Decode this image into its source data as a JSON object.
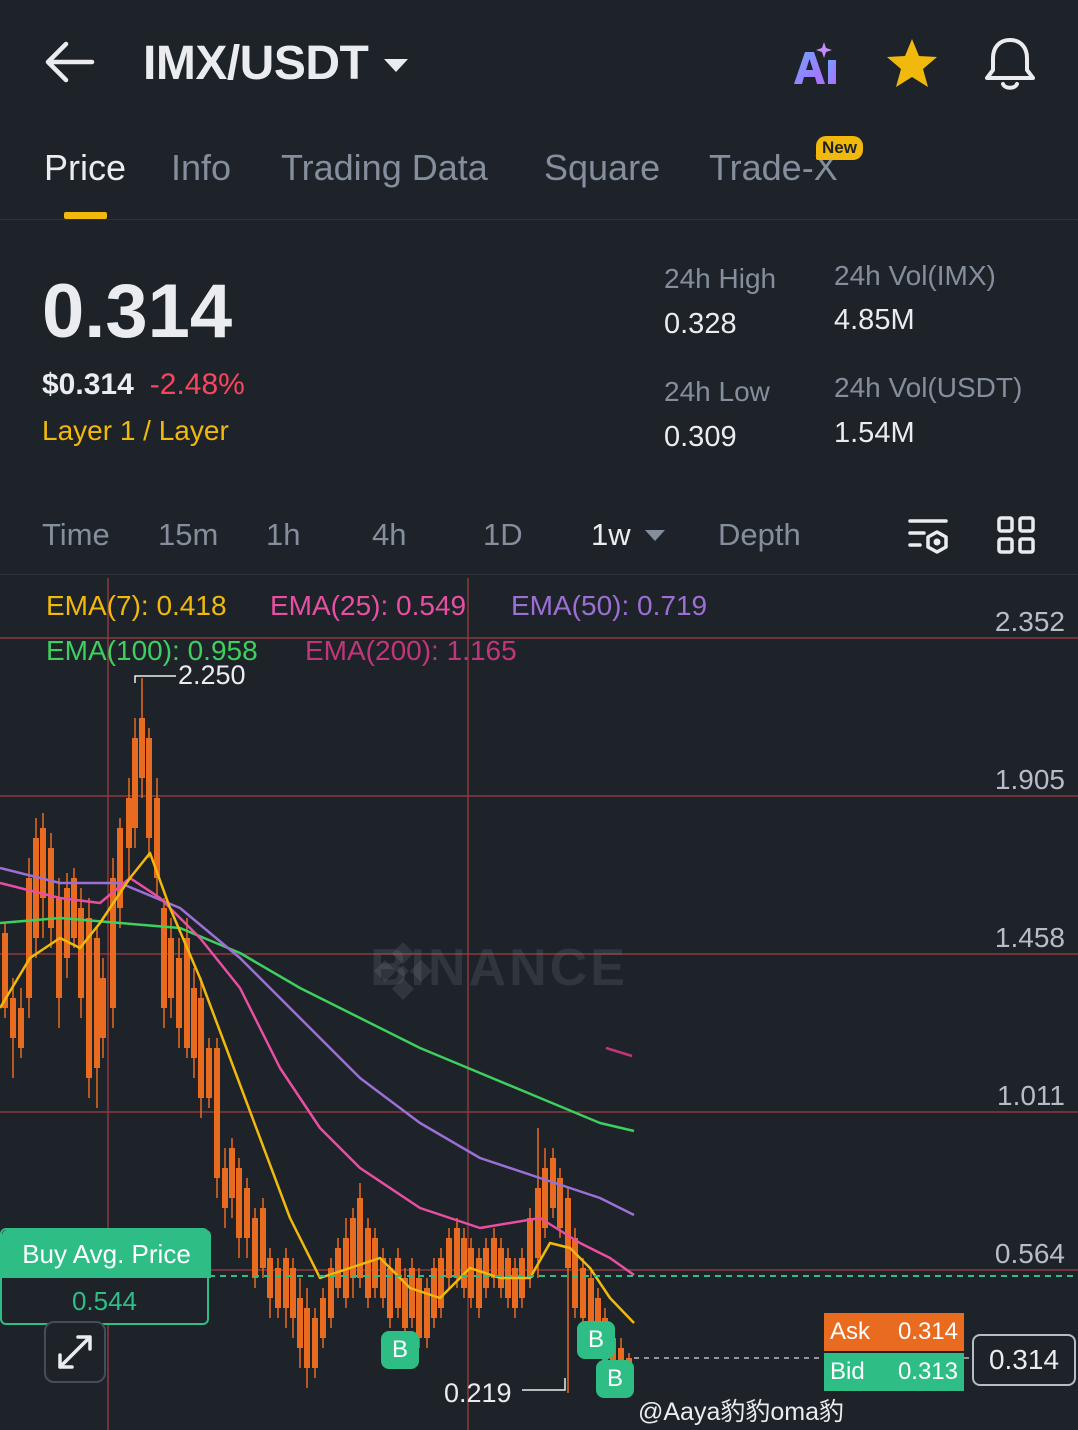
{
  "header": {
    "pair": "IMX/USDT",
    "ai_label": "AI"
  },
  "tabs": [
    {
      "label": "Price"
    },
    {
      "label": "Info"
    },
    {
      "label": "Trading Data"
    },
    {
      "label": "Square"
    },
    {
      "label": "Trade-X"
    }
  ],
  "new_badge": "New",
  "price": {
    "last": "0.314",
    "usd": "$0.314",
    "change": "-2.48%",
    "category": "Layer 1 / Layer"
  },
  "stats": {
    "high_label": "24h High",
    "high": "0.328",
    "low_label": "24h Low",
    "low": "0.309",
    "vol_base_label": "24h Vol(IMX)",
    "vol_base": "4.85M",
    "vol_quote_label": "24h Vol(USDT)",
    "vol_quote": "1.54M"
  },
  "intervals": [
    {
      "label": "Time"
    },
    {
      "label": "15m"
    },
    {
      "label": "1h"
    },
    {
      "label": "4h"
    },
    {
      "label": "1D"
    },
    {
      "label": "1w"
    },
    {
      "label": "Depth"
    }
  ],
  "ema": {
    "ema7": "EMA(7): 0.418",
    "ema25": "EMA(25): 0.549",
    "ema50": "EMA(50): 0.719",
    "ema100": "EMA(100): 0.958",
    "ema200": "EMA(200): 1.165"
  },
  "colors": {
    "ema7": "#f0b90b",
    "ema25": "#e84fa3",
    "ema50": "#9c6fd6",
    "ema100": "#3ecf5e",
    "ema200": "#c2357a",
    "up": "#2ebd85",
    "down": "#e96b1f",
    "gridline": "#8a3a3f"
  },
  "y_axis": [
    "2.352",
    "1.905",
    "1.458",
    "1.011",
    "0.564"
  ],
  "chart_labels": {
    "high_marker": "2.250",
    "low_marker": "0.219",
    "watermark": "BINANCE"
  },
  "avg_price": {
    "title": "Buy Avg. Price",
    "value": "0.544"
  },
  "orderbook": {
    "ask_label": "Ask",
    "ask": "0.314",
    "bid_label": "Bid",
    "bid": "0.313"
  },
  "current_price_tag": "0.314",
  "buy_marker": "B",
  "footer_mark": "@Aaya豹豹oma豹"
}
